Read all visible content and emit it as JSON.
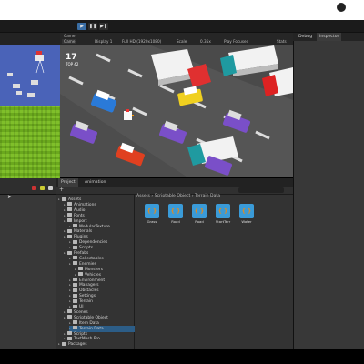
{
  "toolbar": {
    "play": "▶",
    "pause": "❚❚",
    "step": "▶❚"
  },
  "game_header": {
    "tab": "Game",
    "display": "Game",
    "display_num": "Display 1",
    "resolution": "Full HD (1920x1080)",
    "scale_label": "Scale",
    "scale_value": "0.35x",
    "play_mode": "Play Focused",
    "stats": "Stats"
  },
  "game_hud": {
    "score": "17",
    "best": "TOP 42"
  },
  "inspector_tabs": [
    "Debug",
    "Inspector"
  ],
  "project_tabs": [
    "Project",
    "Animation"
  ],
  "project_add": "+",
  "breadcrumb": "Assets › Scriptable Object › Terrain Data",
  "tree": [
    {
      "label": "Assets",
      "depth": 0,
      "sel": false
    },
    {
      "label": "Animations",
      "depth": 1,
      "sel": false
    },
    {
      "label": "Audio",
      "depth": 1,
      "sel": false
    },
    {
      "label": "Fonts",
      "depth": 1,
      "sel": false
    },
    {
      "label": "Import",
      "depth": 1,
      "sel": false
    },
    {
      "label": "ModularTexture",
      "depth": 2,
      "sel": false
    },
    {
      "label": "Materials",
      "depth": 1,
      "sel": false
    },
    {
      "label": "Plugins",
      "depth": 1,
      "sel": false
    },
    {
      "label": "Dependencies",
      "depth": 2,
      "sel": false
    },
    {
      "label": "Scripts",
      "depth": 2,
      "sel": false
    },
    {
      "label": "Prefabs",
      "depth": 1,
      "sel": false
    },
    {
      "label": "Collectables",
      "depth": 2,
      "sel": false
    },
    {
      "label": "Enemies",
      "depth": 2,
      "sel": false
    },
    {
      "label": "Monsters",
      "depth": 3,
      "sel": false
    },
    {
      "label": "Vehicles",
      "depth": 3,
      "sel": false
    },
    {
      "label": "Environment",
      "depth": 2,
      "sel": false
    },
    {
      "label": "Managers",
      "depth": 2,
      "sel": false
    },
    {
      "label": "Obstacles",
      "depth": 2,
      "sel": false
    },
    {
      "label": "Settings",
      "depth": 2,
      "sel": false
    },
    {
      "label": "Terrain",
      "depth": 2,
      "sel": false
    },
    {
      "label": "UI",
      "depth": 2,
      "sel": false
    },
    {
      "label": "Scenes",
      "depth": 1,
      "sel": false
    },
    {
      "label": "Scriptable Object",
      "depth": 1,
      "sel": false
    },
    {
      "label": "Item Data",
      "depth": 2,
      "sel": false
    },
    {
      "label": "Terrain Data",
      "depth": 2,
      "sel": true
    },
    {
      "label": "Scripts",
      "depth": 1,
      "sel": false
    },
    {
      "label": "TextMesh Pro",
      "depth": 1,
      "sel": false
    },
    {
      "label": "Packages",
      "depth": 0,
      "sel": false
    }
  ],
  "assets": [
    "Grass",
    "Road",
    "Road",
    "StartTerr",
    "Water"
  ],
  "colors": {
    "selection": "#2c5d87",
    "asset_icon": "#3a9bd8",
    "grass": "#7fbf2a",
    "water": "#4a63b8"
  }
}
